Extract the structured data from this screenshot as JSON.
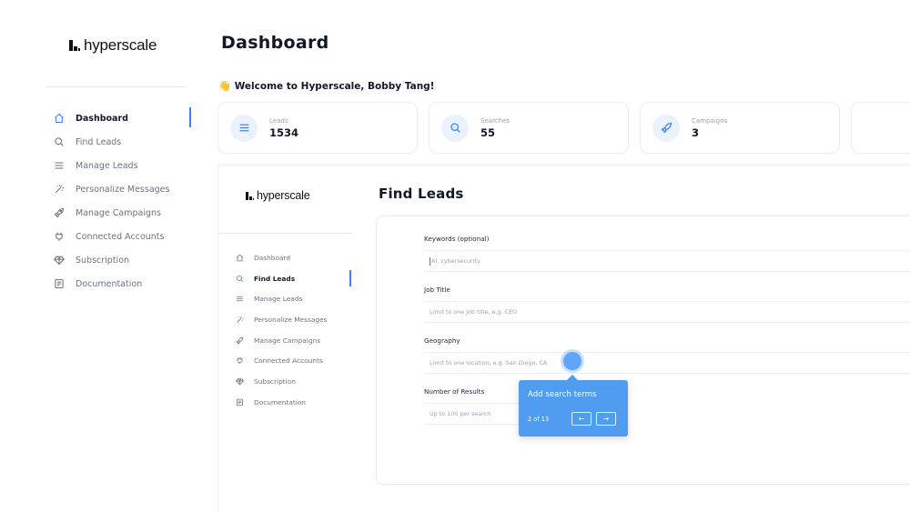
{
  "brand": {
    "name": "hyperscale"
  },
  "header": {
    "title": "Dashboard"
  },
  "welcome": {
    "emoji": "👋",
    "text": "Welcome to Hyperscale, Bobby Tang!"
  },
  "sidebar": {
    "items": [
      {
        "label": "Dashboard",
        "icon": "home-icon",
        "active": true
      },
      {
        "label": "Find Leads",
        "icon": "search-icon",
        "active": false
      },
      {
        "label": "Manage Leads",
        "icon": "list-icon",
        "active": false
      },
      {
        "label": "Personalize Messages",
        "icon": "magic-wand-icon",
        "active": false
      },
      {
        "label": "Manage Campaigns",
        "icon": "rocket-icon",
        "active": false
      },
      {
        "label": "Connected Accounts",
        "icon": "plug-icon",
        "active": false
      },
      {
        "label": "Subscription",
        "icon": "diamond-icon",
        "active": false
      },
      {
        "label": "Documentation",
        "icon": "document-icon",
        "active": false
      }
    ]
  },
  "stats": [
    {
      "label": "Leads",
      "value": "1534",
      "icon": "list-icon"
    },
    {
      "label": "Searches",
      "value": "55",
      "icon": "search-icon"
    },
    {
      "label": "Campaigns",
      "value": "3",
      "icon": "rocket-icon"
    }
  ],
  "panel": {
    "brand": "hyperscale",
    "title": "Find Leads",
    "sidebar": {
      "items": [
        {
          "label": "Dashboard",
          "active": false
        },
        {
          "label": "Find Leads",
          "active": true
        },
        {
          "label": "Manage Leads",
          "active": false
        },
        {
          "label": "Personalize Messages",
          "active": false
        },
        {
          "label": "Manage Campaigns",
          "active": false
        },
        {
          "label": "Connected Accounts",
          "active": false
        },
        {
          "label": "Subscription",
          "active": false
        },
        {
          "label": "Documentation",
          "active": false
        }
      ]
    },
    "form": {
      "keywords": {
        "label": "Keywords (optional)",
        "placeholder": "AI, cybersecurity"
      },
      "job_title": {
        "label": "Job Title",
        "placeholder": "Limit to one job title, e.g. CEO"
      },
      "geography": {
        "label": "Geography",
        "placeholder": "Limit to one location, e.g. San Diego, CA"
      },
      "results": {
        "label": "Number of Results",
        "placeholder": "Up to 100 per search"
      }
    }
  },
  "tour": {
    "title": "Add search terms",
    "step": "2 of 13",
    "prev": "←",
    "next": "→"
  },
  "colors": {
    "accent": "#3b82f6",
    "tooltip": "#4f9cf0",
    "badge_bg": "#eaf2ff"
  }
}
